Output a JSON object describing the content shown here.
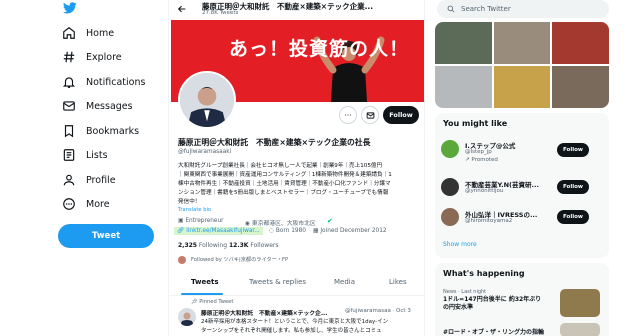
{
  "nav": {
    "items": [
      {
        "label": "Home",
        "icon": "home-icon"
      },
      {
        "label": "Explore",
        "icon": "hashtag-icon"
      },
      {
        "label": "Notifications",
        "icon": "bell-icon"
      },
      {
        "label": "Messages",
        "icon": "envelope-icon"
      },
      {
        "label": "Bookmarks",
        "icon": "bookmark-icon"
      },
      {
        "label": "Lists",
        "icon": "list-icon"
      },
      {
        "label": "Profile",
        "icon": "person-icon"
      },
      {
        "label": "More",
        "icon": "more-circle-icon"
      }
    ],
    "tweet_label": "Tweet"
  },
  "header": {
    "title": "藤原正明＠大和財託　不動産×建築×テック企業...",
    "tweet_count": "27.8K Tweets"
  },
  "banner": {
    "text": "あっ！投資筋の人！"
  },
  "profile": {
    "follow_label": "Follow",
    "name": "藤原正明＠大和財託　不動産×建築×テック企業の社長",
    "handle": "@fujiwaramasaaki",
    "bio_lines": [
      "大和財託グループ創業社長｜会社ヒコオ無し一人で起業｜創業9年｜売上105億円",
      "｜関東関西で事業展開｜資産運用コンサルティング｜1棟新築物件開発＆建築請負｜1",
      "棟中古物件再生｜不動産投資｜土地活用｜賃貸管理｜不動産小口化ファンド｜分譲マ",
      "ンション管理｜書籍を5冊出版しまとベストセラー｜ブログ・ユーチューブでも情報",
      "発信中！"
    ],
    "translate_label": "Translate bio",
    "category": "Entrepreneur",
    "location": "東京都港区、大阪市北区",
    "website": "linktr.ee/Masaakifujiwar...",
    "born": "Born 1980",
    "joined": "Joined December 2012",
    "following_count": "2,325",
    "following_label": "Following",
    "followers_count": "12.3K",
    "followers_label": "Followers",
    "followed_by": "Followed by ツバキ|京都のライター・FP"
  },
  "tabs": [
    "Tweets",
    "Tweets & replies",
    "Media",
    "Likes"
  ],
  "pinned": {
    "label": "Pinned Tweet",
    "author": "藤原正明＠大和財託　不動産×建築×テック企...",
    "handle_time": "@fujiwaramasaa · Oct 3",
    "lines": [
      "24新卒採用が本格スタート！ということで、今月に東京と大阪で1day-イン",
      "ターンシップをそれぞれ開催します。私も参加し、学生の皆さんとコミュ"
    ]
  },
  "right": {
    "search_placeholder": "Search Twitter",
    "you_might_like": "You might like",
    "suggestions": [
      {
        "name": "I.ステップ@公式",
        "handle": "@Istep_jp",
        "meta": "Promoted",
        "avatar_color": "#5aa83c"
      },
      {
        "name": "不動産芸業Y.N(芸資研...",
        "handle": "@ynnonittijou",
        "meta": "",
        "avatar_color": "#333333"
      },
      {
        "name": "外山弘洋｜IVRESSの...",
        "handle": "@hiromitoyama2",
        "meta": "",
        "avatar_color": "#8a6a55"
      }
    ],
    "follow_label": "Follow",
    "show_more": "Show more",
    "whats_happening": "What's happening",
    "trends": [
      {
        "meta": "News · Last night",
        "title": "1ドル=147円台後半に 約32年ぶりの円安水準"
      },
      {
        "meta": "",
        "title": "#ロード・オブ・ザ・リング力の指輪"
      }
    ]
  },
  "colors": {
    "accent": "#1d9bf0",
    "banner": "#e31e25",
    "verified_green": "#00ba7c"
  }
}
